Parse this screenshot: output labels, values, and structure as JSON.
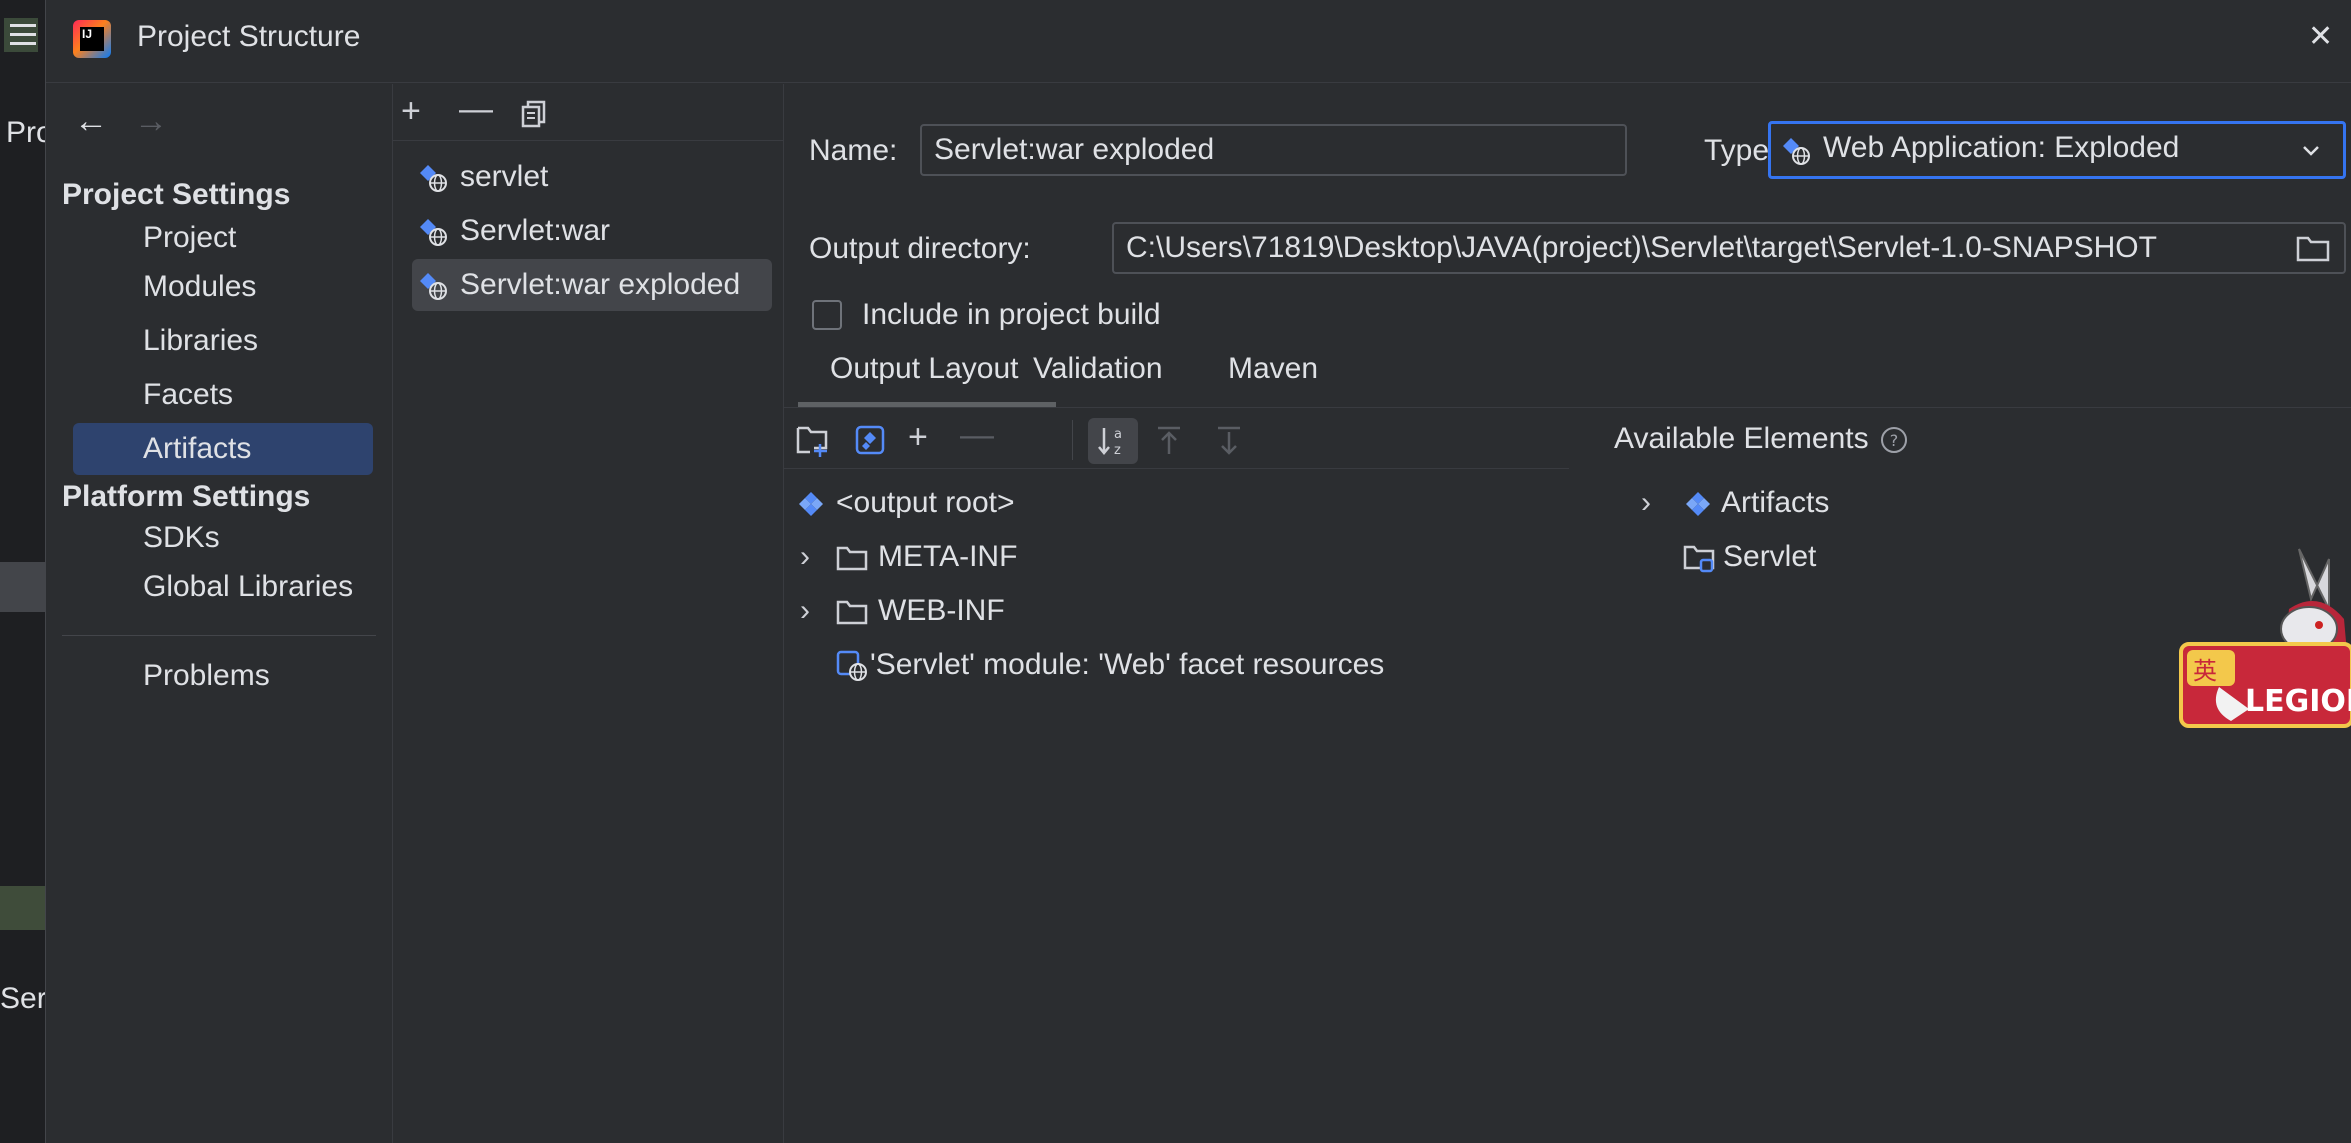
{
  "ide": {
    "partial_text_top": "Pro",
    "partial_text_bottom": "Serv"
  },
  "dialog": {
    "title": "Project Structure"
  },
  "nav": {
    "project_settings_header": "Project Settings",
    "project_settings_items": [
      {
        "label": "Project"
      },
      {
        "label": "Modules"
      },
      {
        "label": "Libraries"
      },
      {
        "label": "Facets"
      },
      {
        "label": "Artifacts",
        "selected": true
      }
    ],
    "platform_settings_header": "Platform Settings",
    "platform_settings_items": [
      {
        "label": "SDKs"
      },
      {
        "label": "Global Libraries"
      }
    ],
    "problems": "Problems"
  },
  "artifacts": [
    {
      "label": "servlet"
    },
    {
      "label": "Servlet:war"
    },
    {
      "label": "Servlet:war exploded",
      "selected": true
    }
  ],
  "form": {
    "name_label": "Name:",
    "name_value": "Servlet:war exploded",
    "type_label": "Type:",
    "type_value": "Web Application: Exploded",
    "output_label": "Output directory:",
    "output_value": "C:\\Users\\71819\\Desktop\\JAVA(project)\\Servlet\\target\\Servlet-1.0-SNAPSHOT",
    "include_label": "Include in project build",
    "include_checked": false
  },
  "tabs": [
    {
      "label": "Output Layout",
      "active": true
    },
    {
      "label": "Validation"
    },
    {
      "label": "Maven"
    }
  ],
  "layout_tree": [
    {
      "label": "<output root>",
      "icon": "artifact-icon"
    },
    {
      "label": "META-INF",
      "icon": "folder-icon",
      "expandable": true
    },
    {
      "label": "WEB-INF",
      "icon": "folder-icon",
      "expandable": true
    },
    {
      "label": "'Servlet' module: 'Web' facet resources",
      "icon": "web-facet-icon"
    }
  ],
  "available": {
    "header": "Available Elements",
    "items": [
      {
        "label": "Artifacts",
        "icon": "artifact-icon",
        "expandable": true
      },
      {
        "label": "Servlet",
        "icon": "module-folder-icon"
      }
    ]
  },
  "mascot": {
    "badge_char": "英",
    "brand_text": "LEGION"
  },
  "colors": {
    "accent": "#3574f0",
    "selection": "#2e436e",
    "background": "#2b2d30"
  }
}
